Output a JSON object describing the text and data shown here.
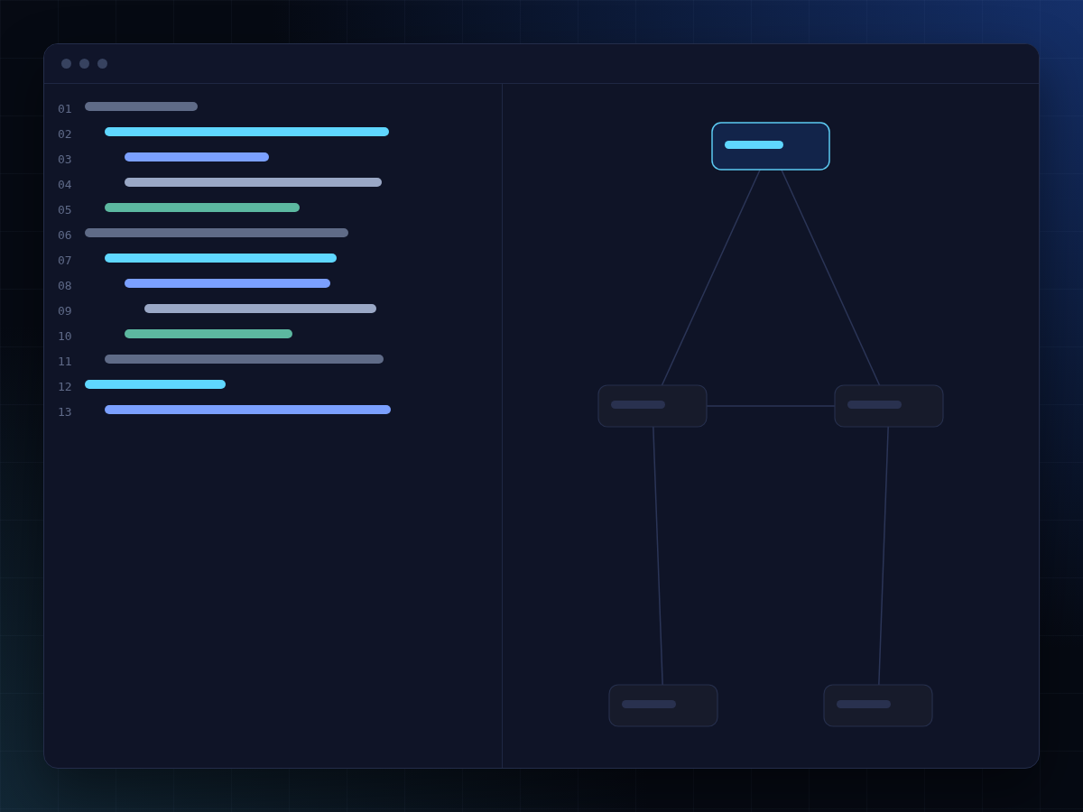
{
  "editor": {
    "lines": [
      {
        "number": "01",
        "color": "#5f6b87",
        "children": [
          {
            "number": "02",
            "color": "#5fd7ff",
            "children": [
              {
                "number": "03",
                "color": "#7ba0ff"
              },
              {
                "number": "04",
                "color": "#9aa8c6"
              }
            ]
          },
          {
            "number": "05",
            "color": "#5cb8a0"
          }
        ]
      },
      {
        "number": "06",
        "color": "#5f6b87",
        "children": [
          {
            "number": "07",
            "color": "#5fd7ff",
            "children": [
              {
                "number": "08",
                "color": "#7ba0ff",
                "children": [
                  {
                    "number": "09",
                    "color": "#9aa8c6"
                  }
                ]
              },
              {
                "number": "10",
                "color": "#5cb8a0"
              }
            ]
          },
          {
            "number": "11",
            "color": "#5f6b87"
          }
        ]
      },
      {
        "number": "12",
        "color": "#5fd7ff",
        "children": [
          {
            "number": "13",
            "color": "#7ba0ff"
          }
        ]
      }
    ]
  },
  "diagram": {
    "nodes": [
      {
        "selected": true,
        "children": [
          {
            "selected": false,
            "children": [
              {
                "selected": false
              }
            ]
          },
          {
            "selected": false,
            "children": [
              {
                "selected": false
              }
            ]
          }
        ]
      }
    ],
    "siblings_linked": true
  }
}
